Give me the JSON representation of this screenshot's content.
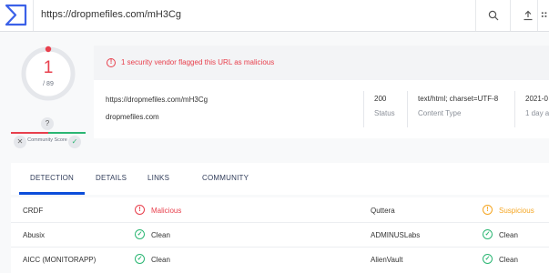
{
  "topbar": {
    "url": "https://dropmefiles.com/mH3Cg",
    "icons": [
      "virustotal-logo",
      "search-icon",
      "upload-icon",
      "apps-icon"
    ]
  },
  "score": {
    "detections": "1",
    "total": "/ 89",
    "community_label": "Community Score",
    "question": "?",
    "vote_down": "✕",
    "vote_up": "✓"
  },
  "summary": {
    "alert": "1 security vendor flagged this URL as malicious",
    "url": "https://dropmefiles.com/mH3Cg",
    "domain": "dropmefiles.com",
    "status_value": "200",
    "status_label": "Status",
    "content_type_value": "text/html; charset=UTF-8",
    "content_type_label": "Content Type",
    "date_value": "2021-0",
    "date_label": "1 day ag"
  },
  "tabs": [
    "DETECTION",
    "DETAILS",
    "LINKS",
    "COMMUNITY"
  ],
  "detections": [
    {
      "vendor_left": "CRDF",
      "verdict_left": "Malicious",
      "status_left": "malicious",
      "vendor_right": "Quttera",
      "verdict_right": "Suspicious",
      "status_right": "suspicious"
    },
    {
      "vendor_left": "Abusix",
      "verdict_left": "Clean",
      "status_left": "clean",
      "vendor_right": "ADMINUSLabs",
      "verdict_right": "Clean",
      "status_right": "clean"
    },
    {
      "vendor_left": "AICC (MONITORAPP)",
      "verdict_left": "Clean",
      "status_left": "clean",
      "vendor_right": "AlienVault",
      "verdict_right": "Clean",
      "status_right": "clean"
    }
  ],
  "colors": {
    "malicious": "#e8404d",
    "clean": "#2bb673",
    "suspicious": "#f5a623",
    "accent": "#0b4dda"
  }
}
